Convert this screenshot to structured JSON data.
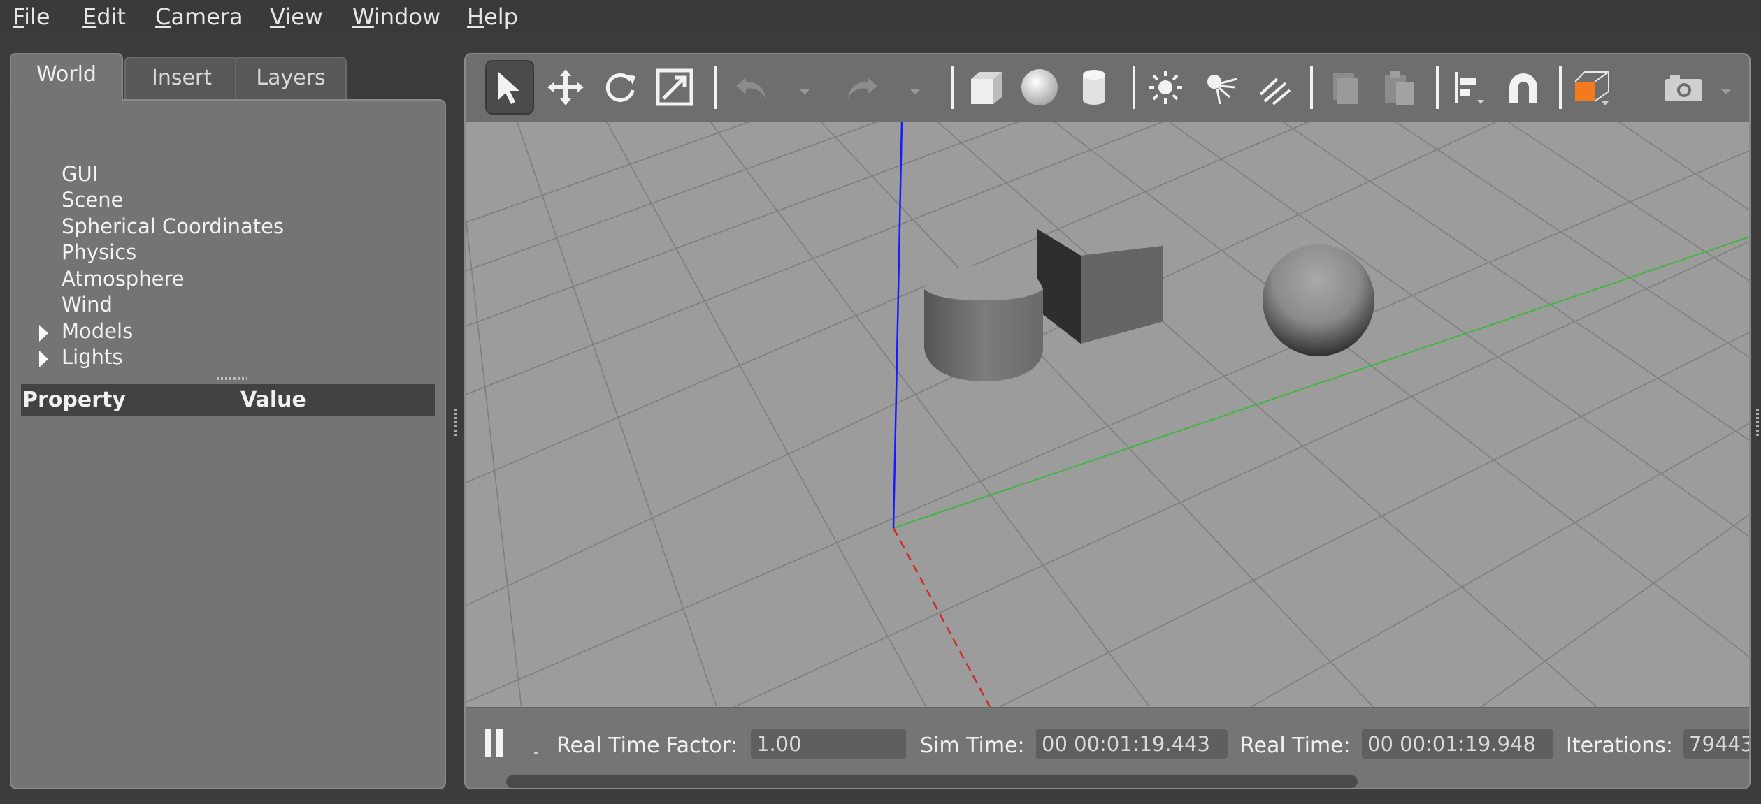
{
  "menu": {
    "file": "File",
    "edit": "Edit",
    "camera": "Camera",
    "view": "View",
    "window": "Window",
    "help": "Help"
  },
  "left_panel": {
    "tabs": [
      "World",
      "Insert",
      "Layers"
    ],
    "active_tab": "World",
    "tree": [
      "GUI",
      "Scene",
      "Spherical Coordinates",
      "Physics",
      "Atmosphere",
      "Wind",
      "Models",
      "Lights"
    ],
    "expandable": [
      "Models",
      "Lights"
    ],
    "property_header": {
      "property": "Property",
      "value": "Value"
    }
  },
  "toolbar": {
    "icons": [
      "select-arrow-icon",
      "translate-icon",
      "rotate-icon",
      "scale-icon",
      "undo-icon",
      "redo-icon",
      "box-icon",
      "sphere-icon",
      "cylinder-icon",
      "point-light-icon",
      "spot-light-icon",
      "directional-light-icon",
      "copy-icon",
      "paste-icon",
      "align-icon",
      "snap-magnet-icon",
      "view-angle-icon",
      "screenshot-icon"
    ],
    "accent_color": "#f47a1f"
  },
  "scene": {
    "objects": [
      "box",
      "cylinder",
      "sphere"
    ],
    "axis_colors": {
      "x": "#d0292a",
      "y": "#3fb73f",
      "z": "#1a1aff"
    },
    "background": "#9c9c9c"
  },
  "statusbar": {
    "real_time_factor_label": "Real Time Factor:",
    "real_time_factor": "1.00",
    "sim_time_label": "Sim Time:",
    "sim_time": "00 00:01:19.443",
    "real_time_label": "Real Time:",
    "real_time": "00 00:01:19.948",
    "iterations_label": "Iterations:",
    "iterations": "79443"
  }
}
